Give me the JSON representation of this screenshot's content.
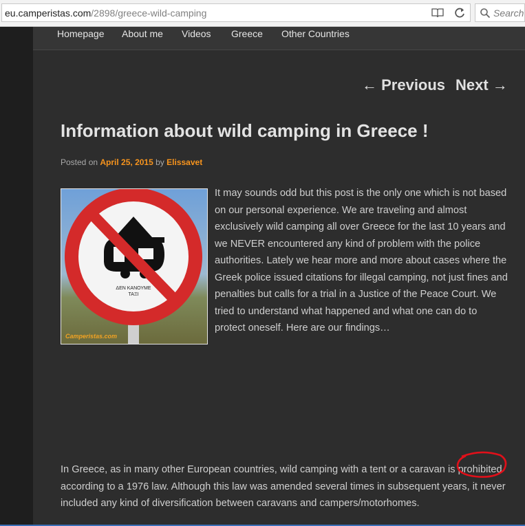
{
  "browser": {
    "url_host": "eu.camperistas.com",
    "url_path": "/2898/greece-wild-camping",
    "search_placeholder": "Search"
  },
  "nav": {
    "items": [
      "Homepage",
      "About me",
      "Videos",
      "Greece",
      "Other Countries"
    ]
  },
  "post_nav": {
    "previous": "← Previous",
    "next": "Next →"
  },
  "post": {
    "title": "Information about wild camping in Greece !",
    "posted_on_label": "Posted on",
    "date": "April 25, 2015",
    "by_label": "by",
    "author": "Elissavet",
    "intro": "It may sounds odd but this post is the only one which is not based on our personal experience. We are traveling and almost exclusively wild camping all over Greece for the last 10 years and we NEVER encountered any kind of problem with the police authorities. Lately we hear more and more about cases where the Greek police issued citations for illegal camping, not just fines and penalties but calls for a trial in a Justice of the Peace Court. We tried to understand what happened and what one can do to protect oneself. Here are our findings…",
    "body_before": "In Greece, as in many other European countries, wild camping with a tent or a caravan is ",
    "body_highlight": "prohibited",
    "body_after": " according to a 1976 law. Although this law was amended several times in subsequent years, it never included any kind of diversification between caravans and campers/motorhomes."
  },
  "image": {
    "sign_text_line1": "ΔΕΝ ΚΑΝΟΥΜΕ",
    "sign_text_line2": "ΤΑΞΙ",
    "watermark": "Camperistas.com"
  },
  "colors": {
    "accent": "#f7941d",
    "highlight_circle": "#e0101a",
    "page_bg": "#2d2d2d",
    "outer_bg": "#1e1e1e"
  }
}
